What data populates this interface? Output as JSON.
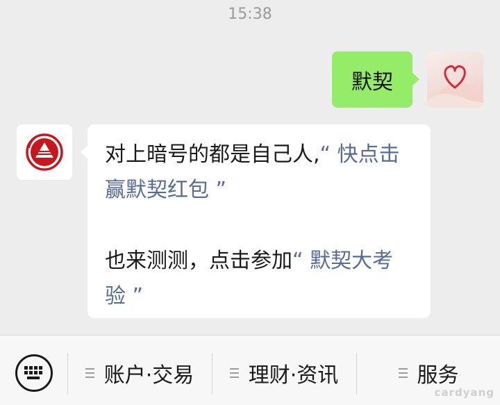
{
  "status": {
    "time": "15:38"
  },
  "messages": {
    "outgoing": {
      "text": "默契",
      "avatar_icon": "heart-hand-photo"
    },
    "incoming": {
      "avatar_icon": "red-triangle-logo",
      "line1_prefix": "对上暗号的都是自己人,",
      "line1_link": "“ 快点击赢默契红包 ”",
      "line2_prefix": "也来测测，点击参加",
      "line2_link": "“ 默契大考验 ”"
    }
  },
  "menu": {
    "keyboard_icon": "keyboard-icon",
    "items": [
      {
        "label": "账户·交易"
      },
      {
        "label": "理财·资讯"
      },
      {
        "label": "服务"
      }
    ]
  },
  "watermark": "cardyang",
  "colors": {
    "background": "#ededed",
    "outgoing_bubble": "#95ec69",
    "incoming_bubble": "#ffffff",
    "link": "#576b95",
    "logo_red": "#c8161d"
  }
}
